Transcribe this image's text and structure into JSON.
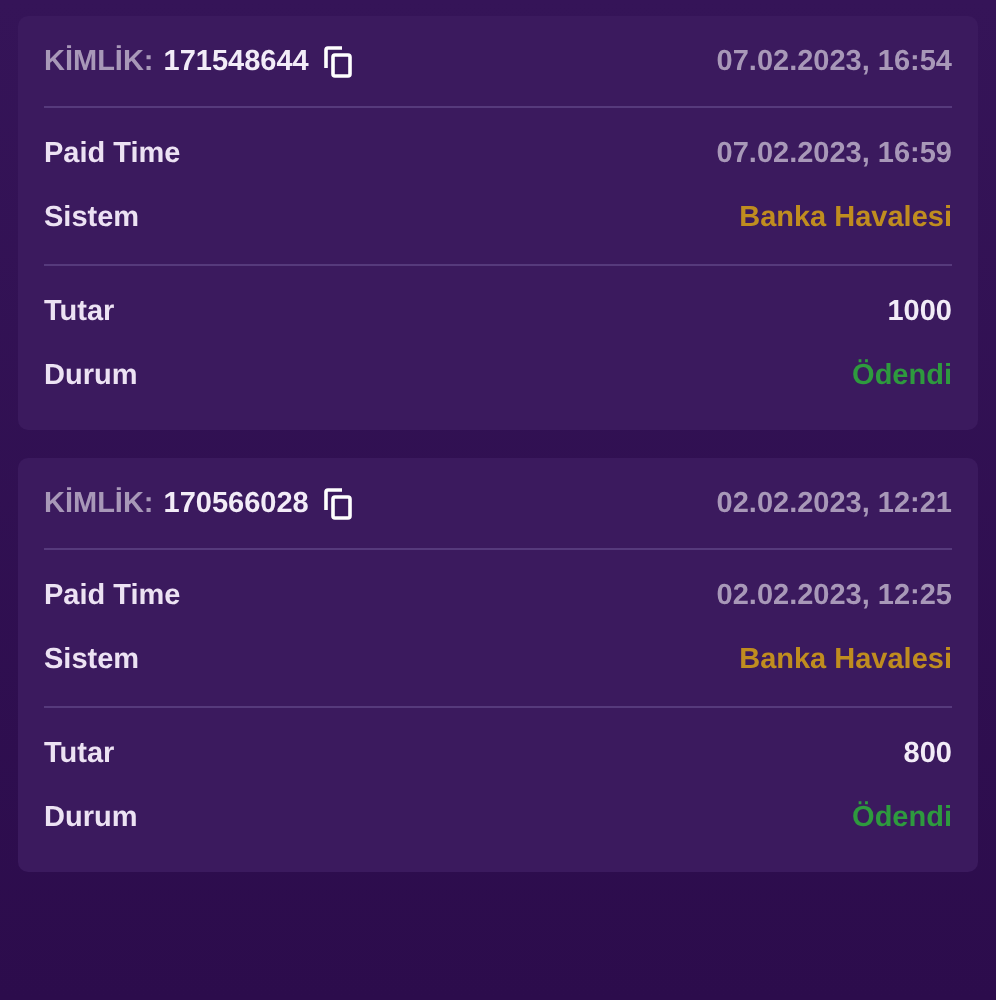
{
  "transactions": [
    {
      "id_label": "KİMLİK:",
      "id": "171548644",
      "created": "07.02.2023, 16:54",
      "groups": [
        [
          {
            "label": "Paid Time",
            "value": "07.02.2023, 16:59",
            "kind": "time"
          },
          {
            "label": "Sistem",
            "value": "Banka Havalesi",
            "kind": "method"
          }
        ],
        [
          {
            "label": "Tutar",
            "value": "1000",
            "kind": "amount"
          },
          {
            "label": "Durum",
            "value": "Ödendi",
            "kind": "status"
          }
        ]
      ]
    },
    {
      "id_label": "KİMLİK:",
      "id": "170566028",
      "created": "02.02.2023, 12:21",
      "groups": [
        [
          {
            "label": "Paid Time",
            "value": "02.02.2023, 12:25",
            "kind": "time"
          },
          {
            "label": "Sistem",
            "value": "Banka Havalesi",
            "kind": "method"
          }
        ],
        [
          {
            "label": "Tutar",
            "value": "800",
            "kind": "amount"
          },
          {
            "label": "Durum",
            "value": "Ödendi",
            "kind": "status"
          }
        ]
      ]
    }
  ]
}
